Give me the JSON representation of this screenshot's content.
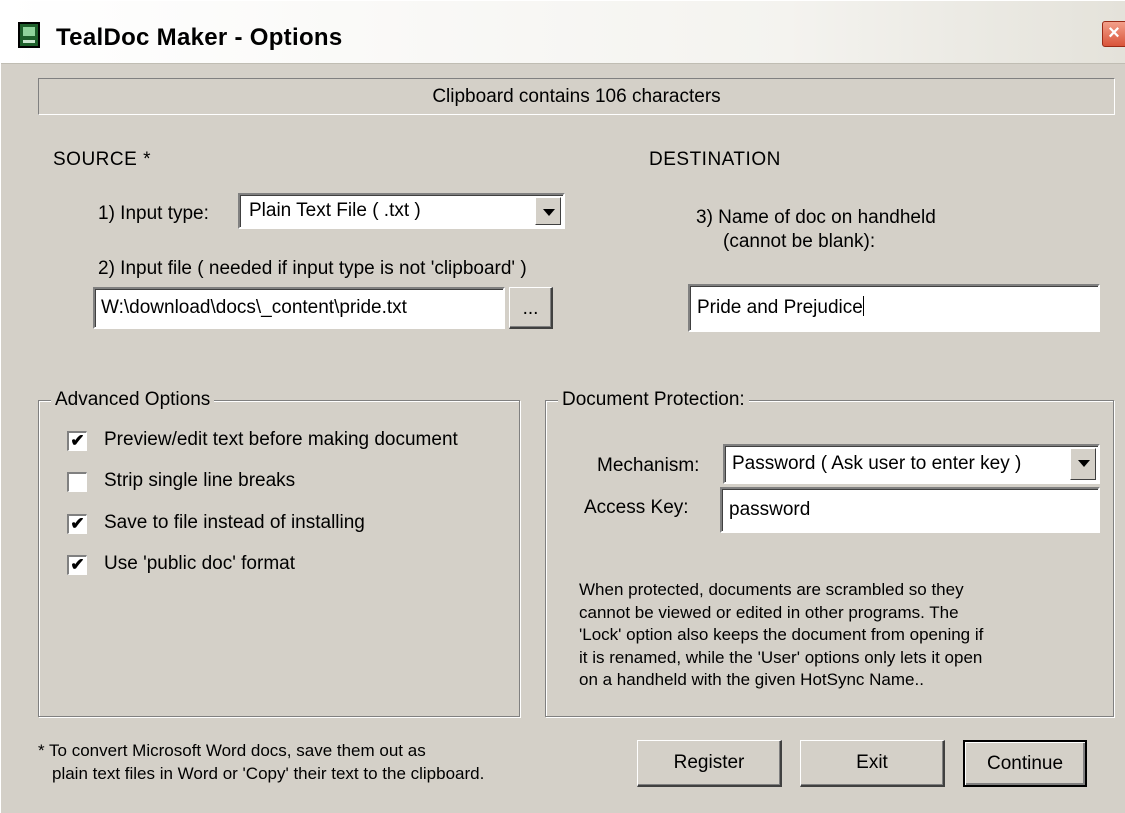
{
  "window": {
    "title": "TealDoc Maker - Options",
    "close_glyph": "×"
  },
  "status": "Clipboard contains 106 characters",
  "source": {
    "heading": "SOURCE *",
    "input_type_label": "1)  Input type:",
    "input_type_value": "Plain Text File ( .txt )",
    "input_file_label": "2)  Input file ( needed if input type is not 'clipboard' )",
    "input_file_value": "W:\\download\\docs\\_content\\pride.txt",
    "browse_label": "..."
  },
  "destination": {
    "heading": "DESTINATION",
    "name_label_line1": "3)  Name of doc on handheld",
    "name_label_line2": "(cannot be blank):",
    "name_value": "Pride and Prejudice"
  },
  "advanced": {
    "legend": "Advanced Options",
    "options": [
      {
        "label": "Preview/edit text before making document",
        "checked": true
      },
      {
        "label": "Strip single line breaks",
        "checked": false
      },
      {
        "label": "Save to file instead of installing",
        "checked": true
      },
      {
        "label": "Use 'public doc' format",
        "checked": true
      }
    ]
  },
  "protection": {
    "legend": "Document Protection:",
    "mechanism_label": "Mechanism:",
    "mechanism_value": "Password ( Ask user to enter key )",
    "access_key_label": "Access Key:",
    "access_key_value": "password",
    "description_lines": [
      "When protected, documents are scrambled so they",
      "cannot be viewed or edited in other programs.  The",
      "'Lock' option also keeps the document from opening if",
      "it is renamed, while the 'User' options only lets it open",
      "on a handheld with the given HotSync Name.."
    ]
  },
  "footnote": {
    "line1": "* To convert Microsoft Word docs, save them out as",
    "line2": "plain text files in Word or 'Copy' their text to the clipboard."
  },
  "buttons": {
    "register": "Register",
    "exit": "Exit",
    "continue": "Continue"
  }
}
